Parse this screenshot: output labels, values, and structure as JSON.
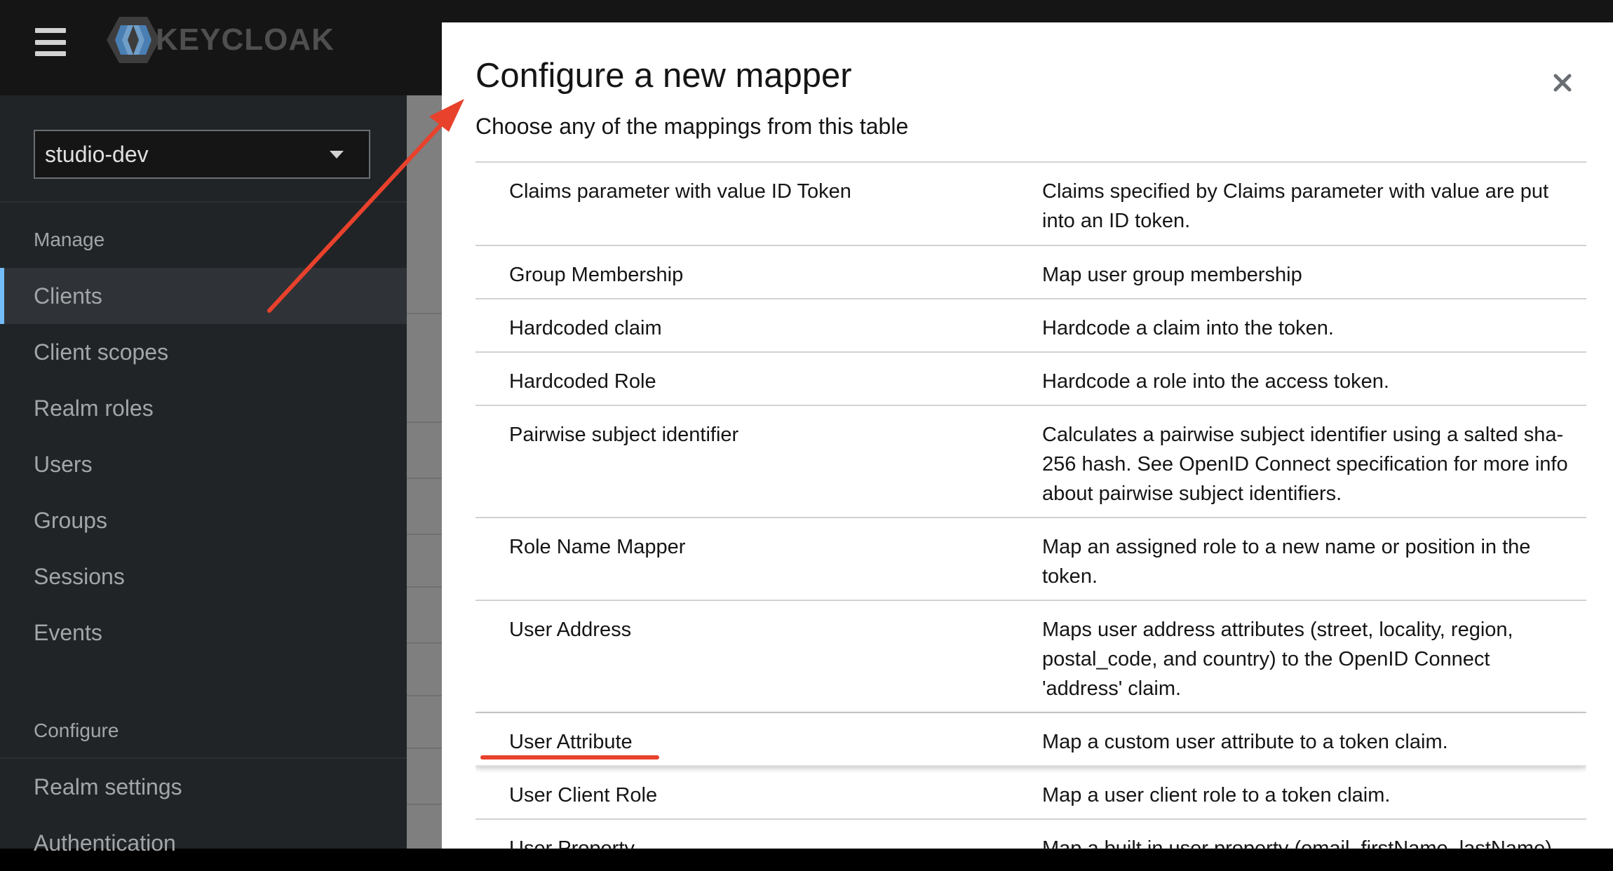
{
  "header": {
    "brand": "KEYCLOAK",
    "icons": {
      "menu": "hamburger-menu-icon",
      "logo": "keycloak-logo-icon"
    }
  },
  "sidebar": {
    "realm": "studio-dev",
    "sections": [
      {
        "title": "Manage",
        "items": [
          "Clients",
          "Client scopes",
          "Realm roles",
          "Users",
          "Groups",
          "Sessions",
          "Events"
        ]
      },
      {
        "title": "Configure",
        "items": [
          "Realm settings",
          "Authentication"
        ]
      }
    ],
    "active_item": "Clients"
  },
  "modal": {
    "title": "Configure a new mapper",
    "description": "Choose any of the mappings from this table",
    "close_icon": "close-icon",
    "rows": [
      {
        "name": "Claims parameter with value ID Token",
        "description": "Claims specified by Claims parameter with value are put into an ID token."
      },
      {
        "name": "Group Membership",
        "description": "Map user group membership"
      },
      {
        "name": "Hardcoded claim",
        "description": "Hardcode a claim into the token."
      },
      {
        "name": "Hardcoded Role",
        "description": "Hardcode a role into the access token."
      },
      {
        "name": "Pairwise subject identifier",
        "description": "Calculates a pairwise subject identifier using a salted sha-256 hash. See OpenID Connect specification for more info about pairwise subject identifiers."
      },
      {
        "name": "Role Name Mapper",
        "description": "Map an assigned role to a new name or position in the token."
      },
      {
        "name": "User Address",
        "description": "Maps user address attributes (street, locality, region, postal_code, and country) to the OpenID Connect 'address' claim."
      },
      {
        "name": "User Attribute",
        "description": "Map a custom user attribute to a token claim."
      },
      {
        "name": "User Client Role",
        "description": "Map a user client role to a token claim."
      },
      {
        "name": "User Property",
        "description": "Map a built in user property (email, firstName, lastName)"
      }
    ],
    "selected_row": "User Attribute"
  },
  "colors": {
    "masthead": "#151515",
    "sidebar": "#212427",
    "active_accent": "#73bcf7",
    "annotation": "#e8412c"
  }
}
